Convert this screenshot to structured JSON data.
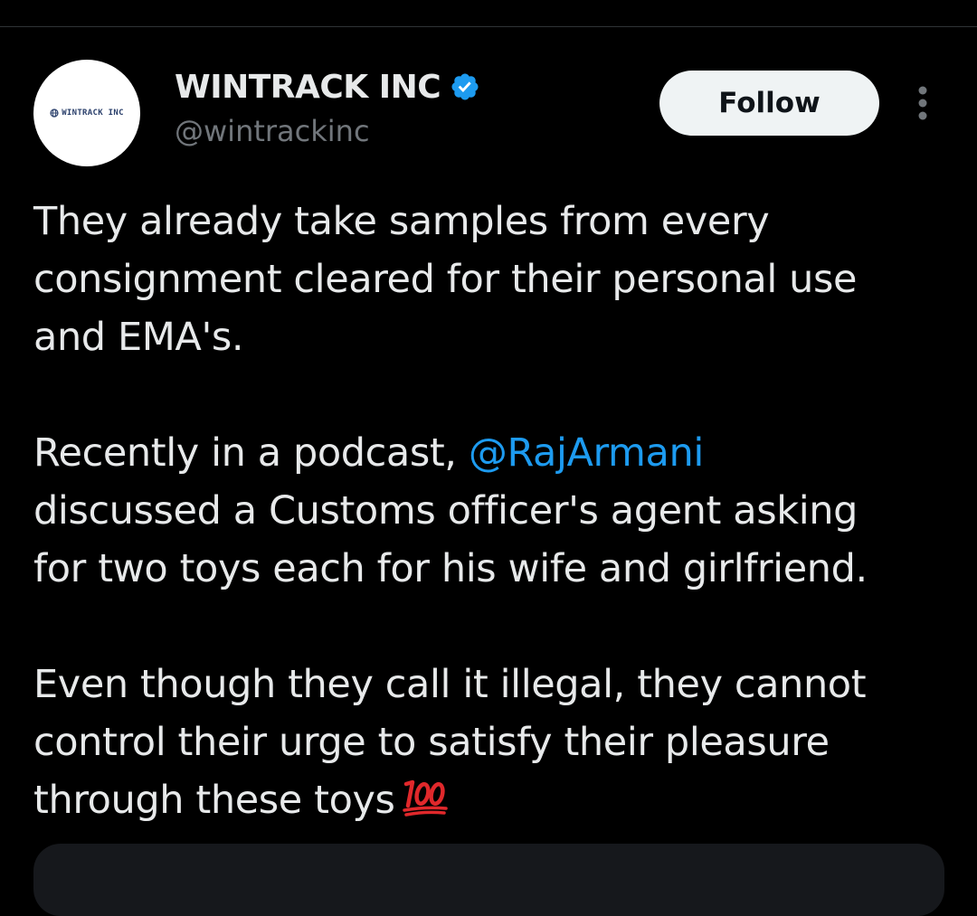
{
  "author": {
    "display_name": "WINTRACK INC",
    "handle": "@wintrackinc",
    "avatar_text": "WINTRACK INC",
    "verified": true,
    "verified_color": "#1d9bf0"
  },
  "actions": {
    "follow_label": "Follow",
    "more_icon": "more-vertical-icon"
  },
  "tweet": {
    "para1": {
      "line1": "They already take samples from every",
      "line2": "consignment cleared for their personal use",
      "line3": "and EMA's."
    },
    "para2": {
      "line1_prefix": "Recently in a podcast, ",
      "mention": "@RajArmani",
      "line2": "discussed a Customs officer's agent asking",
      "line3": "for two toys each for his wife and girlfriend."
    },
    "para3": {
      "line1": "Even though they call it illegal, they cannot",
      "line2": "control their urge to satisfy their pleasure",
      "line3": "through these toys",
      "emoji": "hundred-points-emoji"
    }
  },
  "colors": {
    "background": "#000000",
    "text": "#e7e9ea",
    "secondary_text": "#71767b",
    "link": "#1d9bf0",
    "follow_bg": "#eff3f4",
    "card_bg": "#16181c"
  }
}
